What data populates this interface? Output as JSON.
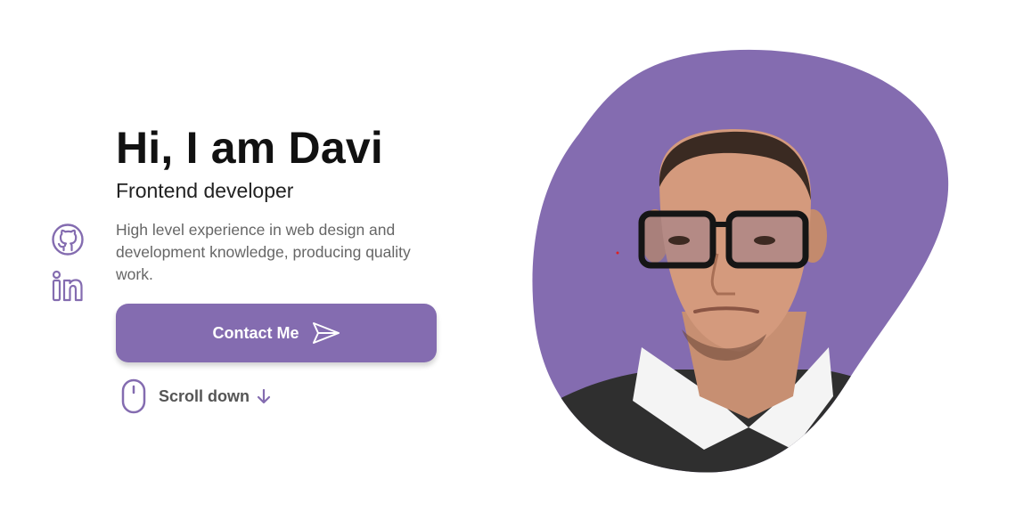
{
  "hero": {
    "title": "Hi, I am Davi",
    "subtitle": "Frontend developer",
    "description": "High level experience in web design and development knowledge, producing quality work.",
    "contact_button_label": "Contact Me",
    "scroll_label": "Scroll down"
  },
  "socials": [
    {
      "icon": "github-icon"
    },
    {
      "icon": "linkedin-icon"
    }
  ],
  "colors": {
    "accent": "#846cb0",
    "title": "#111111",
    "text": "#666666",
    "button_text": "#ffffff"
  },
  "icons": {
    "contact": "send-icon",
    "scroll": "mouse-icon",
    "scroll_arrow": "arrow-down-icon"
  }
}
